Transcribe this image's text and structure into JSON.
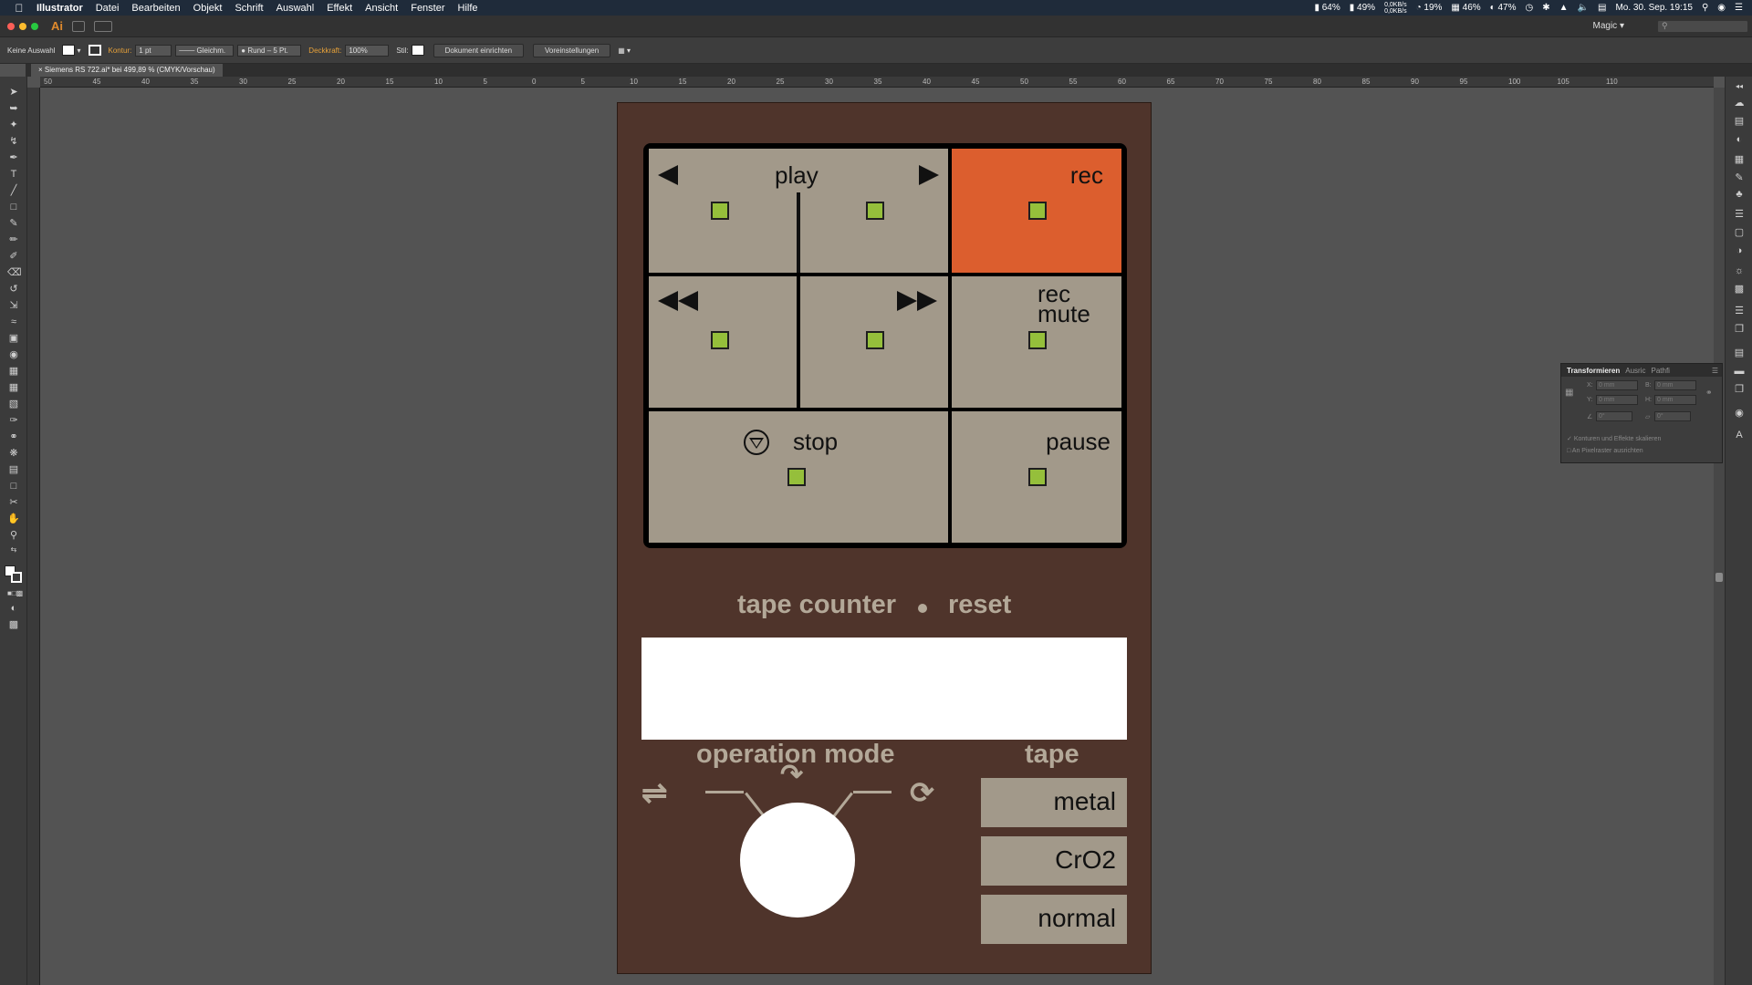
{
  "menubar": {
    "app_name": "Illustrator",
    "items": [
      "Datei",
      "Bearbeiten",
      "Objekt",
      "Schrift",
      "Auswahl",
      "Effekt",
      "Ansicht",
      "Fenster",
      "Hilfe"
    ],
    "status": {
      "battery1": "64%",
      "battery2": "49%",
      "net_up": "0,0KB/s",
      "net_down": "0,0KB/s",
      "cpu": "19%",
      "mem": "46%",
      "disk": "47%",
      "datetime": "Mo. 30. Sep. 19:15"
    }
  },
  "titlebar": {
    "logo": "Ai",
    "workspace": "Magic"
  },
  "controlbar": {
    "selection": "Keine Auswahl",
    "stroke_label": "Kontur:",
    "stroke_value": "1 pt",
    "stroke_style": "Gleichm.",
    "brush": "Rund – 5 Pt.",
    "opacity_label": "Deckkraft:",
    "opacity_value": "100%",
    "style_label": "Stil:",
    "doc_setup": "Dokument einrichten",
    "preferences": "Voreinstellungen"
  },
  "document": {
    "tab_title": "Siemens RS 722.ai* bei 499,89 % (CMYK/Vorschau)"
  },
  "ruler": {
    "h_labels": [
      "50",
      "45",
      "40",
      "35",
      "30",
      "25",
      "20",
      "15",
      "10",
      "5",
      "0",
      "5",
      "10",
      "15",
      "20",
      "25",
      "30",
      "35",
      "40",
      "45",
      "50",
      "55",
      "60",
      "65",
      "70",
      "75",
      "80",
      "85",
      "90",
      "95",
      "100",
      "105",
      "110"
    ]
  },
  "transform_panel": {
    "tabs": [
      "Transformieren",
      "Ausric",
      "Pathfi"
    ],
    "x_label": "X:",
    "y_label": "Y:",
    "w_label": "B:",
    "h_label": "H:",
    "x_value": "0 mm",
    "y_value": "0 mm",
    "w_value": "0 mm",
    "h_value": "0 mm",
    "angle_value": "0°",
    "shear_value": "0°",
    "option1": "Konturen und Effekte skalieren",
    "option2": "An Pixelraster ausrichten"
  },
  "artwork": {
    "buttons": {
      "play": "play",
      "rec": "rec",
      "rec_mute_line1": "rec",
      "rec_mute_line2": "mute",
      "stop": "stop",
      "pause": "pause"
    },
    "counter": {
      "label": "tape counter",
      "reset": "reset"
    },
    "operation_mode": "operation mode",
    "tape": {
      "label": "tape",
      "options": [
        "metal",
        "CrO2",
        "normal"
      ]
    },
    "colors": {
      "panel": "#4f342b",
      "button": "#a2998a",
      "rec": "#dc5e2e",
      "led": "#95bf3b",
      "label": "#b3a898"
    }
  }
}
